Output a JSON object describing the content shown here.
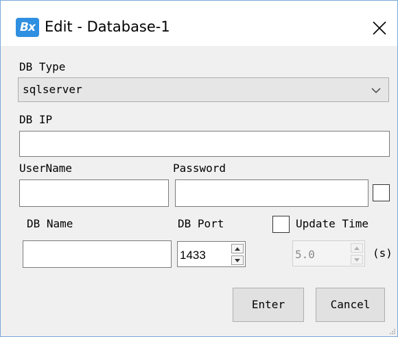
{
  "window": {
    "title": "Edit - Database-1",
    "app_icon_text": "Bx"
  },
  "fields": {
    "db_type_label": "DB Type",
    "db_type_value": "sqlserver",
    "db_ip_label": "DB IP",
    "db_ip_value": "",
    "username_label": "UserName",
    "username_value": "",
    "password_label": "Password",
    "password_value": "",
    "db_name_label": "DB Name",
    "db_name_value": "",
    "db_port_label": "DB Port",
    "db_port_value": "1433",
    "update_time_label": "Update Time",
    "update_time_value": "5.0",
    "unit_label": "(s)"
  },
  "checkboxes": {
    "show_password_checked": false,
    "update_time_checked": false
  },
  "buttons": {
    "enter": "Enter",
    "cancel": "Cancel"
  },
  "icons": [
    "app-icon",
    "close-icon",
    "chevron-down-icon",
    "spin-up-icon",
    "spin-down-icon",
    "resize-grip-icon"
  ],
  "colors": {
    "window_border": "#7aa7d9",
    "app_icon": "#2f8fe0",
    "background": "#f0f0f0"
  }
}
